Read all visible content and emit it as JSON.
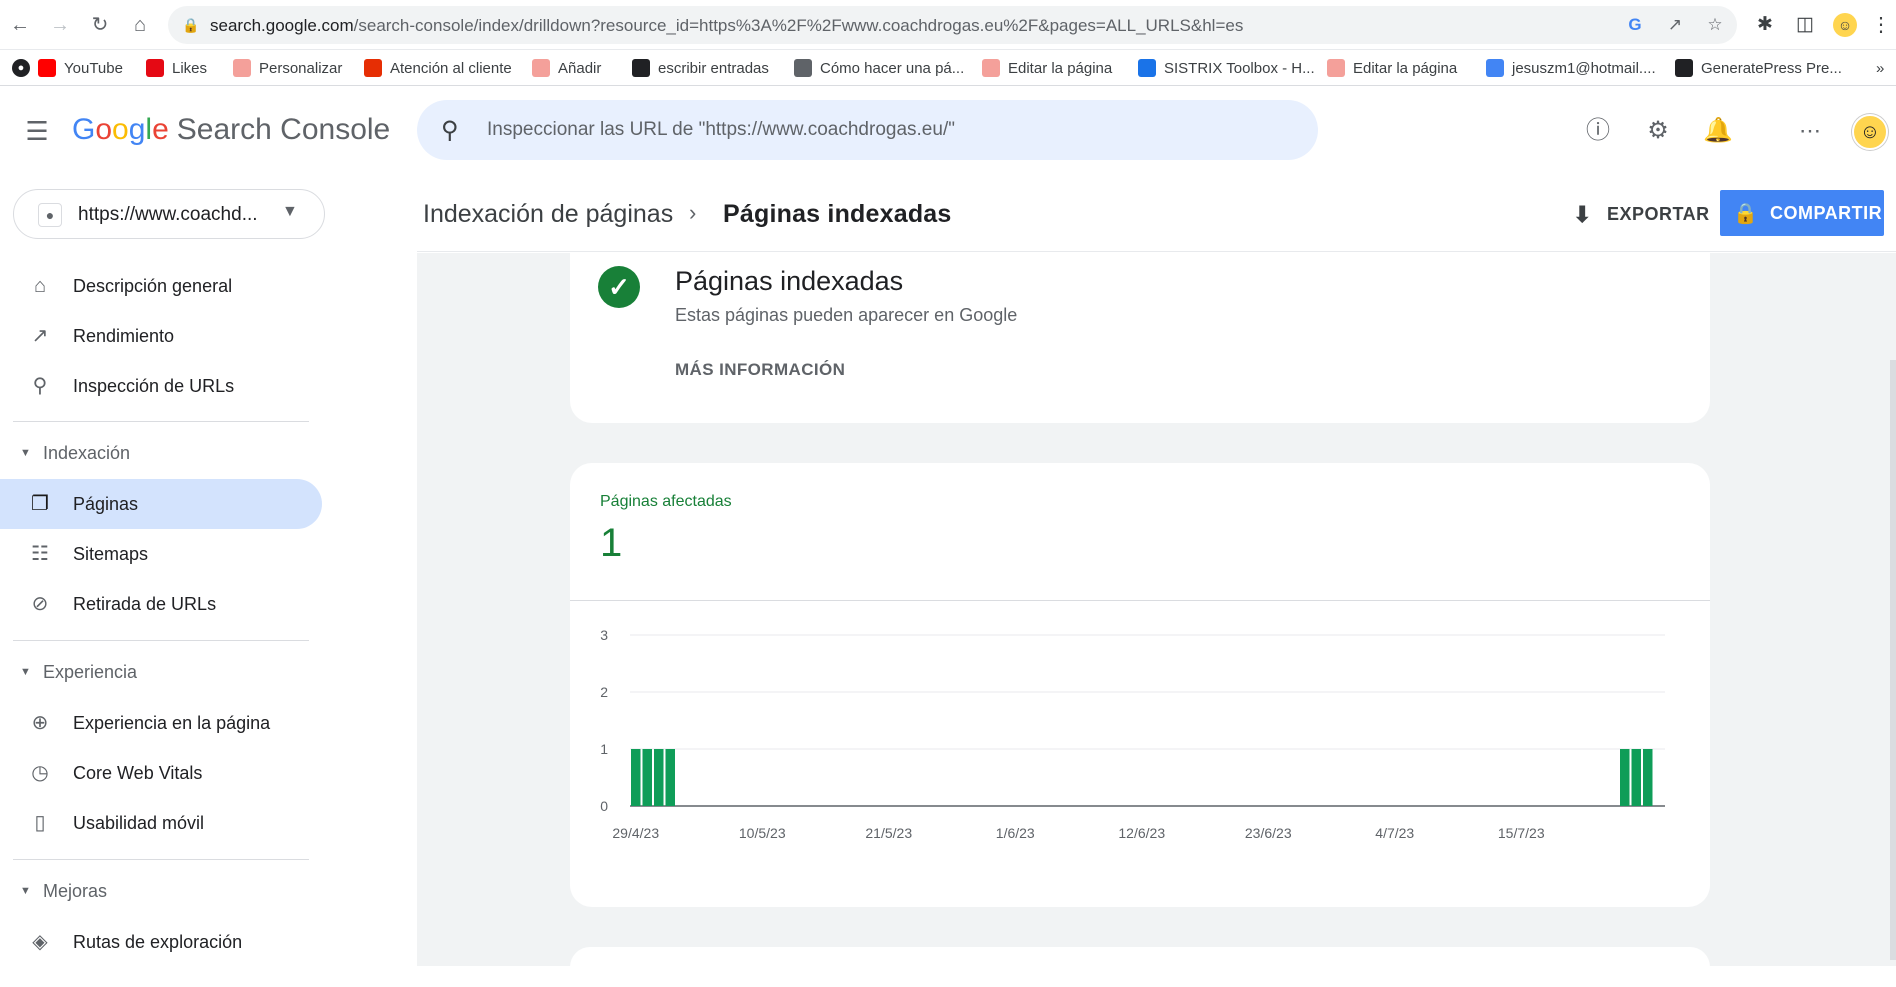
{
  "browser": {
    "url_domain": "search.google.com",
    "url_rest": "/search-console/index/drilldown?resource_id=https%3A%2F%2Fwww.coachdrogas.eu%2F&pages=ALL_URLS&hl=es",
    "bookmarks": [
      {
        "label": "YouTube",
        "icon": "youtube-icon",
        "color": "#ff0000"
      },
      {
        "label": "Likes",
        "icon": "netflix-icon",
        "color": "#e50914"
      },
      {
        "label": "Personalizar",
        "icon": "site-icon",
        "color": "#f4a09a"
      },
      {
        "label": "Atención al cliente",
        "icon": "aliexpress-icon",
        "color": "#e62e04"
      },
      {
        "label": "Añadir",
        "icon": "site-icon",
        "color": "#f4a09a"
      },
      {
        "label": "escribir entradas",
        "icon": "dollar-icon",
        "color": "#202124"
      },
      {
        "label": "Cómo hacer una pá...",
        "icon": "page-icon",
        "color": "#5f6368"
      },
      {
        "label": "Editar la página",
        "icon": "site-icon",
        "color": "#f4a09a"
      },
      {
        "label": "SISTRIX Toolbox - H...",
        "icon": "search-icon",
        "color": "#1a73e8"
      },
      {
        "label": "Editar la página",
        "icon": "site-icon",
        "color": "#f4a09a"
      },
      {
        "label": "jesuszm1@hotmail....",
        "icon": "google-icon",
        "color": "#4285f4"
      },
      {
        "label": "GeneratePress Pre...",
        "icon": "globe-icon",
        "color": "#202124"
      }
    ]
  },
  "header": {
    "logo_google": [
      "G",
      "o",
      "o",
      "g",
      "l",
      "e"
    ],
    "logo_product": "Search Console",
    "search_placeholder": "Inspeccionar las URL de \"https://www.coachdrogas.eu/\""
  },
  "property": {
    "label": "https://www.coachd..."
  },
  "sidebar": {
    "items": [
      {
        "label": "Descripción general",
        "icon": "home-icon"
      },
      {
        "label": "Rendimiento",
        "icon": "trending-up-icon"
      },
      {
        "label": "Inspección de URLs",
        "icon": "search-icon"
      }
    ],
    "sections": [
      {
        "label": "Indexación",
        "items": [
          {
            "label": "Páginas",
            "icon": "pages-icon"
          },
          {
            "label": "Sitemaps",
            "icon": "sitemap-icon"
          },
          {
            "label": "Retirada de URLs",
            "icon": "visibility-off-icon"
          }
        ]
      },
      {
        "label": "Experiencia",
        "items": [
          {
            "label": "Experiencia en la página",
            "icon": "add-circle-icon"
          },
          {
            "label": "Core Web Vitals",
            "icon": "speed-icon"
          },
          {
            "label": "Usabilidad móvil",
            "icon": "phone-icon"
          }
        ]
      },
      {
        "label": "Mejoras",
        "items": [
          {
            "label": "Rutas de exploración",
            "icon": "layers-icon"
          }
        ]
      }
    ]
  },
  "page": {
    "breadcrumb_parent": "Indexación de páginas",
    "breadcrumb_current": "Páginas indexadas",
    "export_label": "EXPORTAR",
    "share_label": "COMPARTIR"
  },
  "status_card": {
    "title": "Páginas indexadas",
    "subtitle": "Estas páginas pueden aparecer en Google",
    "more_label": "MÁS INFORMACIÓN"
  },
  "chart_card": {
    "label": "Páginas afectadas",
    "count": "1"
  },
  "colors": {
    "accent": "#4285f4",
    "success": "#188038",
    "bar": "#0f9d58",
    "active_nav": "#d3e3fd"
  },
  "chart_data": {
    "type": "bar",
    "title": "",
    "xlabel": "",
    "ylabel": "",
    "ylim": [
      0,
      3
    ],
    "yticks": [
      0,
      1,
      2,
      3
    ],
    "xticks": [
      "29/4/23",
      "10/5/23",
      "21/5/23",
      "1/6/23",
      "12/6/23",
      "23/6/23",
      "4/7/23",
      "15/7/23"
    ],
    "x_start": "29/4/23",
    "days": 90,
    "values": [
      1,
      1,
      1,
      1,
      0,
      0,
      0,
      0,
      0,
      0,
      0,
      0,
      0,
      0,
      0,
      0,
      0,
      0,
      0,
      0,
      0,
      0,
      0,
      0,
      0,
      0,
      0,
      0,
      0,
      0,
      0,
      0,
      0,
      0,
      0,
      0,
      0,
      0,
      0,
      0,
      0,
      0,
      0,
      0,
      0,
      0,
      0,
      0,
      0,
      0,
      0,
      0,
      0,
      0,
      0,
      0,
      0,
      0,
      0,
      0,
      0,
      0,
      0,
      0,
      0,
      0,
      0,
      0,
      0,
      0,
      0,
      0,
      0,
      0,
      0,
      0,
      0,
      0,
      0,
      0,
      0,
      0,
      0,
      0,
      0,
      0,
      1,
      1,
      1,
      0
    ],
    "series": [
      {
        "name": "",
        "color": "#0f9d58"
      }
    ]
  }
}
